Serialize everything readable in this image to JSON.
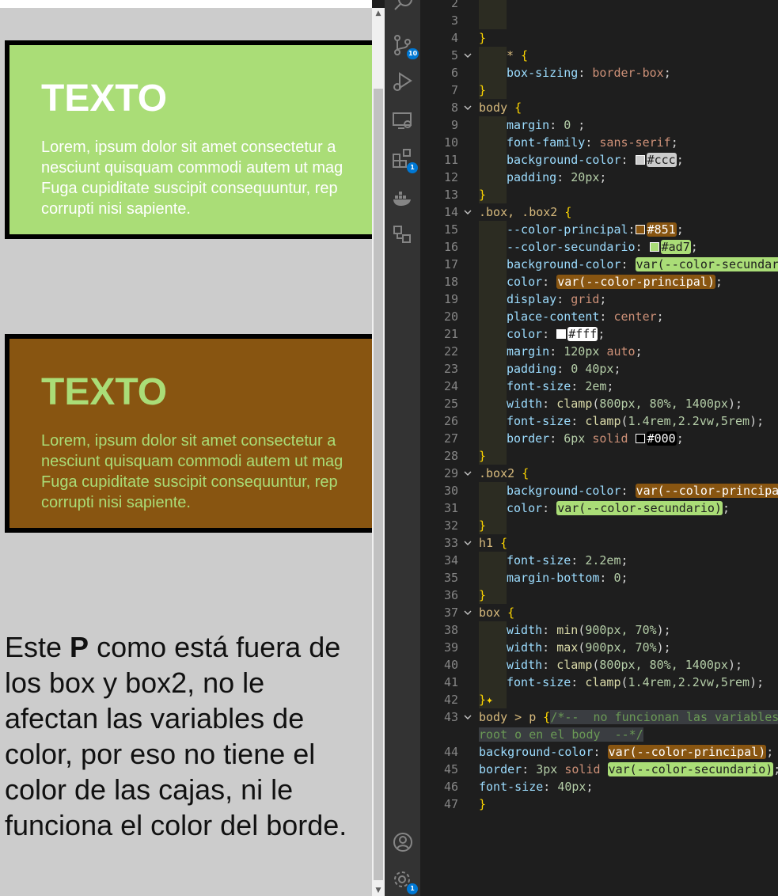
{
  "preview": {
    "box1": {
      "title": "TEXTO",
      "text_lines": [
        "Lorem, ipsum dolor sit amet consectetur a",
        "nesciunt quisquam commodi autem ut mag",
        "Fuga cupiditate suscipit consequuntur, rep",
        "corrupti nisi sapiente."
      ]
    },
    "box2": {
      "title": "TEXTO",
      "text_lines": [
        "Lorem, ipsum dolor sit amet consectetur a",
        "nesciunt quisquam commodi autem ut mag",
        "Fuga cupiditate suscipit consequuntur, rep",
        "corrupti nisi sapiente."
      ]
    },
    "outside_paragraph": {
      "before": "Este ",
      "bold": "P",
      "after": " como está fuera de los box y box2, no le afectan las variables de color, por eso no tiene el color de las cajas, ni le funciona el color del borde."
    }
  },
  "colors": {
    "principal": "#885511",
    "secundario": "#aadd77",
    "page_bg": "#cccccc",
    "editor_bg": "#1e1e1e",
    "activity_bg": "#333333",
    "badge": "#0078d4"
  },
  "activity_bar": [
    {
      "icon": "search-icon",
      "badge": ""
    },
    {
      "icon": "source-control-icon",
      "badge": "10"
    },
    {
      "icon": "run-debug-icon",
      "badge": ""
    },
    {
      "icon": "remote-explorer-icon",
      "badge": ""
    },
    {
      "icon": "extensions-icon",
      "badge": "1"
    },
    {
      "icon": "docker-icon",
      "badge": ""
    },
    {
      "icon": "connections-icon",
      "badge": ""
    },
    {
      "icon": "account-icon",
      "badge": ""
    },
    {
      "icon": "settings-gear-icon",
      "badge": "1"
    }
  ],
  "editor": {
    "line_numbers": [
      "2",
      "3",
      "4",
      "5",
      "6",
      "7",
      "8",
      "9",
      "10",
      "11",
      "12",
      "13",
      "14",
      "15",
      "16",
      "17",
      "18",
      "19",
      "20",
      "21",
      "22",
      "23",
      "24",
      "25",
      "26",
      "27",
      "28",
      "29",
      "30",
      "31",
      "32",
      "33",
      "34",
      "35",
      "36",
      "37",
      "38",
      "39",
      "40",
      "41",
      "42",
      "43",
      "",
      "44",
      "45",
      "46",
      "47"
    ],
    "lines": [
      [
        {
          "t": "",
          "c": ""
        }
      ],
      [
        {
          "t": "",
          "c": ""
        }
      ],
      [
        {
          "t": "}",
          "c": "brace"
        }
      ],
      [
        {
          "t": "* ",
          "c": "sel"
        },
        {
          "t": "{",
          "c": "brace"
        }
      ],
      [
        {
          "t": "box-sizing",
          "c": "prop"
        },
        {
          "t": ": ",
          "c": ""
        },
        {
          "t": "border-box",
          "c": "val"
        },
        {
          "t": ";",
          "c": ""
        }
      ],
      [
        {
          "t": "}",
          "c": "brace"
        }
      ],
      [
        {
          "t": "body ",
          "c": "sel"
        },
        {
          "t": "{",
          "c": "brace"
        }
      ],
      [
        {
          "t": "margin",
          "c": "prop"
        },
        {
          "t": ": ",
          "c": ""
        },
        {
          "t": "0",
          "c": "num"
        },
        {
          "t": " ;",
          "c": ""
        }
      ],
      [
        {
          "t": "font-family",
          "c": "prop"
        },
        {
          "t": ": ",
          "c": ""
        },
        {
          "t": "sans-serif",
          "c": "val"
        },
        {
          "t": ";",
          "c": ""
        }
      ],
      [
        {
          "t": "background-color",
          "c": "prop"
        },
        {
          "t": ": ",
          "c": ""
        },
        {
          "t": "#cccccc",
          "c": "swatch"
        },
        {
          "t": "#ccc",
          "c": "hl hl-c"
        },
        {
          "t": ";",
          "c": ""
        }
      ],
      [
        {
          "t": "padding",
          "c": "prop"
        },
        {
          "t": ": ",
          "c": ""
        },
        {
          "t": "20px",
          "c": "num"
        },
        {
          "t": ";",
          "c": ""
        }
      ],
      [
        {
          "t": "}",
          "c": "brace"
        }
      ],
      [
        {
          "t": ".box, .box2 ",
          "c": "sel"
        },
        {
          "t": "{",
          "c": "brace"
        }
      ],
      [
        {
          "t": "--color-principal",
          "c": "prop"
        },
        {
          "t": ":",
          "c": ""
        },
        {
          "t": "#885511",
          "c": "swatch"
        },
        {
          "t": "#851",
          "c": "hl hl-b"
        },
        {
          "t": ";",
          "c": ""
        }
      ],
      [
        {
          "t": "--color-secundario",
          "c": "prop"
        },
        {
          "t": ": ",
          "c": ""
        },
        {
          "t": "#aadd77",
          "c": "swatch"
        },
        {
          "t": "#ad7",
          "c": "hl hl-g"
        },
        {
          "t": ";",
          "c": ""
        }
      ],
      [
        {
          "t": "background-color",
          "c": "prop"
        },
        {
          "t": ": ",
          "c": ""
        },
        {
          "t": "var(--color-secundario);",
          "c": "hl hl-g"
        }
      ],
      [
        {
          "t": "color",
          "c": "prop"
        },
        {
          "t": ": ",
          "c": ""
        },
        {
          "t": "var(--color-principal)",
          "c": "hl hl-b"
        },
        {
          "t": ";",
          "c": ""
        }
      ],
      [
        {
          "t": "display",
          "c": "prop"
        },
        {
          "t": ": ",
          "c": ""
        },
        {
          "t": "grid",
          "c": "val"
        },
        {
          "t": ";",
          "c": ""
        }
      ],
      [
        {
          "t": "place-content",
          "c": "prop"
        },
        {
          "t": ": ",
          "c": ""
        },
        {
          "t": "center",
          "c": "val"
        },
        {
          "t": ";",
          "c": ""
        }
      ],
      [
        {
          "t": "color",
          "c": "prop"
        },
        {
          "t": ": ",
          "c": ""
        },
        {
          "t": "#ffffff",
          "c": "swatch"
        },
        {
          "t": "#fff",
          "c": "hl hl-w"
        },
        {
          "t": ";",
          "c": ""
        }
      ],
      [
        {
          "t": "margin",
          "c": "prop"
        },
        {
          "t": ": ",
          "c": ""
        },
        {
          "t": "120px",
          "c": "num"
        },
        {
          "t": " ",
          "c": ""
        },
        {
          "t": "auto",
          "c": "val"
        },
        {
          "t": ";",
          "c": ""
        }
      ],
      [
        {
          "t": "padding",
          "c": "prop"
        },
        {
          "t": ": ",
          "c": ""
        },
        {
          "t": "0 40px",
          "c": "num"
        },
        {
          "t": ";",
          "c": ""
        }
      ],
      [
        {
          "t": "font-size",
          "c": "prop"
        },
        {
          "t": ": ",
          "c": ""
        },
        {
          "t": "2em",
          "c": "num"
        },
        {
          "t": ";",
          "c": ""
        }
      ],
      [
        {
          "t": "width",
          "c": "prop"
        },
        {
          "t": ": ",
          "c": ""
        },
        {
          "t": "clamp",
          "c": "fn"
        },
        {
          "t": "(",
          "c": ""
        },
        {
          "t": "800px, 80%, 1400px",
          "c": "num"
        },
        {
          "t": ");",
          "c": ""
        }
      ],
      [
        {
          "t": "font-size",
          "c": "prop"
        },
        {
          "t": ": ",
          "c": ""
        },
        {
          "t": "clamp",
          "c": "fn"
        },
        {
          "t": "(",
          "c": ""
        },
        {
          "t": "1.4rem,2.2vw,5rem",
          "c": "num"
        },
        {
          "t": ");",
          "c": ""
        }
      ],
      [
        {
          "t": "border",
          "c": "prop"
        },
        {
          "t": ": ",
          "c": ""
        },
        {
          "t": "6px",
          "c": "num"
        },
        {
          "t": " ",
          "c": ""
        },
        {
          "t": "solid",
          "c": "val"
        },
        {
          "t": " ",
          "c": ""
        },
        {
          "t": "#000000",
          "c": "swatch"
        },
        {
          "t": "#000",
          "c": "hl hl-k"
        },
        {
          "t": ";",
          "c": ""
        }
      ],
      [
        {
          "t": "}",
          "c": "brace"
        }
      ],
      [
        {
          "t": ".box2 ",
          "c": "sel"
        },
        {
          "t": "{",
          "c": "brace"
        }
      ],
      [
        {
          "t": "background-color",
          "c": "prop"
        },
        {
          "t": ": ",
          "c": ""
        },
        {
          "t": "var(--color-principal);",
          "c": "hl hl-b"
        }
      ],
      [
        {
          "t": "color",
          "c": "prop"
        },
        {
          "t": ": ",
          "c": ""
        },
        {
          "t": "var(--color-secundario)",
          "c": "hl hl-g"
        },
        {
          "t": ";",
          "c": ""
        }
      ],
      [
        {
          "t": "}",
          "c": "brace"
        }
      ],
      [
        {
          "t": "h1 ",
          "c": "sel"
        },
        {
          "t": "{",
          "c": "brace"
        }
      ],
      [
        {
          "t": "font-size",
          "c": "prop"
        },
        {
          "t": ": ",
          "c": ""
        },
        {
          "t": "2.2em",
          "c": "num"
        },
        {
          "t": ";",
          "c": ""
        }
      ],
      [
        {
          "t": "margin-bottom",
          "c": "prop"
        },
        {
          "t": ": ",
          "c": ""
        },
        {
          "t": "0",
          "c": "num"
        },
        {
          "t": ";",
          "c": ""
        }
      ],
      [
        {
          "t": "}",
          "c": "brace"
        }
      ],
      [
        {
          "t": "box ",
          "c": "sel"
        },
        {
          "t": "{",
          "c": "brace"
        }
      ],
      [
        {
          "t": "width",
          "c": "prop"
        },
        {
          "t": ": ",
          "c": ""
        },
        {
          "t": "min",
          "c": "fn"
        },
        {
          "t": "(",
          "c": ""
        },
        {
          "t": "900px, 70%",
          "c": "num"
        },
        {
          "t": ");",
          "c": ""
        }
      ],
      [
        {
          "t": "width",
          "c": "prop"
        },
        {
          "t": ": ",
          "c": ""
        },
        {
          "t": "max",
          "c": "fn"
        },
        {
          "t": "(",
          "c": ""
        },
        {
          "t": "900px, 70%",
          "c": "num"
        },
        {
          "t": ");",
          "c": ""
        }
      ],
      [
        {
          "t": "width",
          "c": "prop"
        },
        {
          "t": ": ",
          "c": ""
        },
        {
          "t": "clamp",
          "c": "fn"
        },
        {
          "t": "(",
          "c": ""
        },
        {
          "t": "800px, 80%, 1400px",
          "c": "num"
        },
        {
          "t": ");",
          "c": ""
        }
      ],
      [
        {
          "t": "font-size",
          "c": "prop"
        },
        {
          "t": ": ",
          "c": ""
        },
        {
          "t": "clamp",
          "c": "fn"
        },
        {
          "t": "(",
          "c": ""
        },
        {
          "t": "1.4rem,2.2vw,5rem",
          "c": "num"
        },
        {
          "t": ");",
          "c": ""
        }
      ],
      [
        {
          "t": "}",
          "c": "brace"
        },
        {
          "t": "✦",
          "c": "sparkle"
        }
      ],
      [
        {
          "t": "body > p ",
          "c": "sel"
        },
        {
          "t": "{",
          "c": "brace"
        },
        {
          "t": "/*--  no funcionan las variables",
          "c": "cm cmtbox"
        }
      ],
      [
        {
          "t": "root o en el body  --*/",
          "c": "cm cmtbox"
        }
      ],
      [
        {
          "t": "background-color",
          "c": "prop"
        },
        {
          "t": ": ",
          "c": ""
        },
        {
          "t": "var(--color-principal)",
          "c": "hl hl-b"
        },
        {
          "t": ";",
          "c": ""
        }
      ],
      [
        {
          "t": "border",
          "c": "prop"
        },
        {
          "t": ": ",
          "c": ""
        },
        {
          "t": "3px",
          "c": "num"
        },
        {
          "t": " ",
          "c": ""
        },
        {
          "t": "solid",
          "c": "val"
        },
        {
          "t": " ",
          "c": ""
        },
        {
          "t": "var(--color-secundario)",
          "c": "hl hl-g"
        },
        {
          "t": ";",
          "c": ""
        }
      ],
      [
        {
          "t": "font-size",
          "c": "prop"
        },
        {
          "t": ": ",
          "c": ""
        },
        {
          "t": "40px",
          "c": "num"
        },
        {
          "t": ";",
          "c": ""
        }
      ],
      [
        {
          "t": "}",
          "c": "brace"
        }
      ]
    ]
  }
}
